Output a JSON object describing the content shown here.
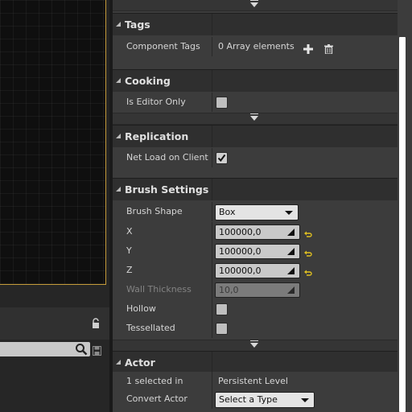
{
  "left_panel": {
    "search_placeholder": ""
  },
  "sections": {
    "tags": {
      "title": "Tags",
      "component_tags_label": "Component Tags",
      "component_tags_value": "0 Array elements"
    },
    "cooking": {
      "title": "Cooking",
      "is_editor_only_label": "Is Editor Only",
      "is_editor_only_checked": false
    },
    "replication": {
      "title": "Replication",
      "net_load_label": "Net Load on Client",
      "net_load_checked": true
    },
    "brush": {
      "title": "Brush Settings",
      "shape_label": "Brush Shape",
      "shape_value": "Box",
      "x_label": "X",
      "x_value": "100000,0",
      "y_label": "Y",
      "y_value": "100000,0",
      "z_label": "Z",
      "z_value": "100000,0",
      "wall_label": "Wall Thickness",
      "wall_value": "10,0",
      "hollow_label": "Hollow",
      "hollow_checked": false,
      "tess_label": "Tessellated",
      "tess_checked": false
    },
    "actor": {
      "title": "Actor",
      "selected_label": "1 selected in",
      "selected_value": "Persistent Level",
      "convert_label": "Convert Actor",
      "convert_value": "Select a Type"
    }
  },
  "colors": {
    "viewport_border": "#c49a3a",
    "reset_arrow": "#e0c020"
  }
}
